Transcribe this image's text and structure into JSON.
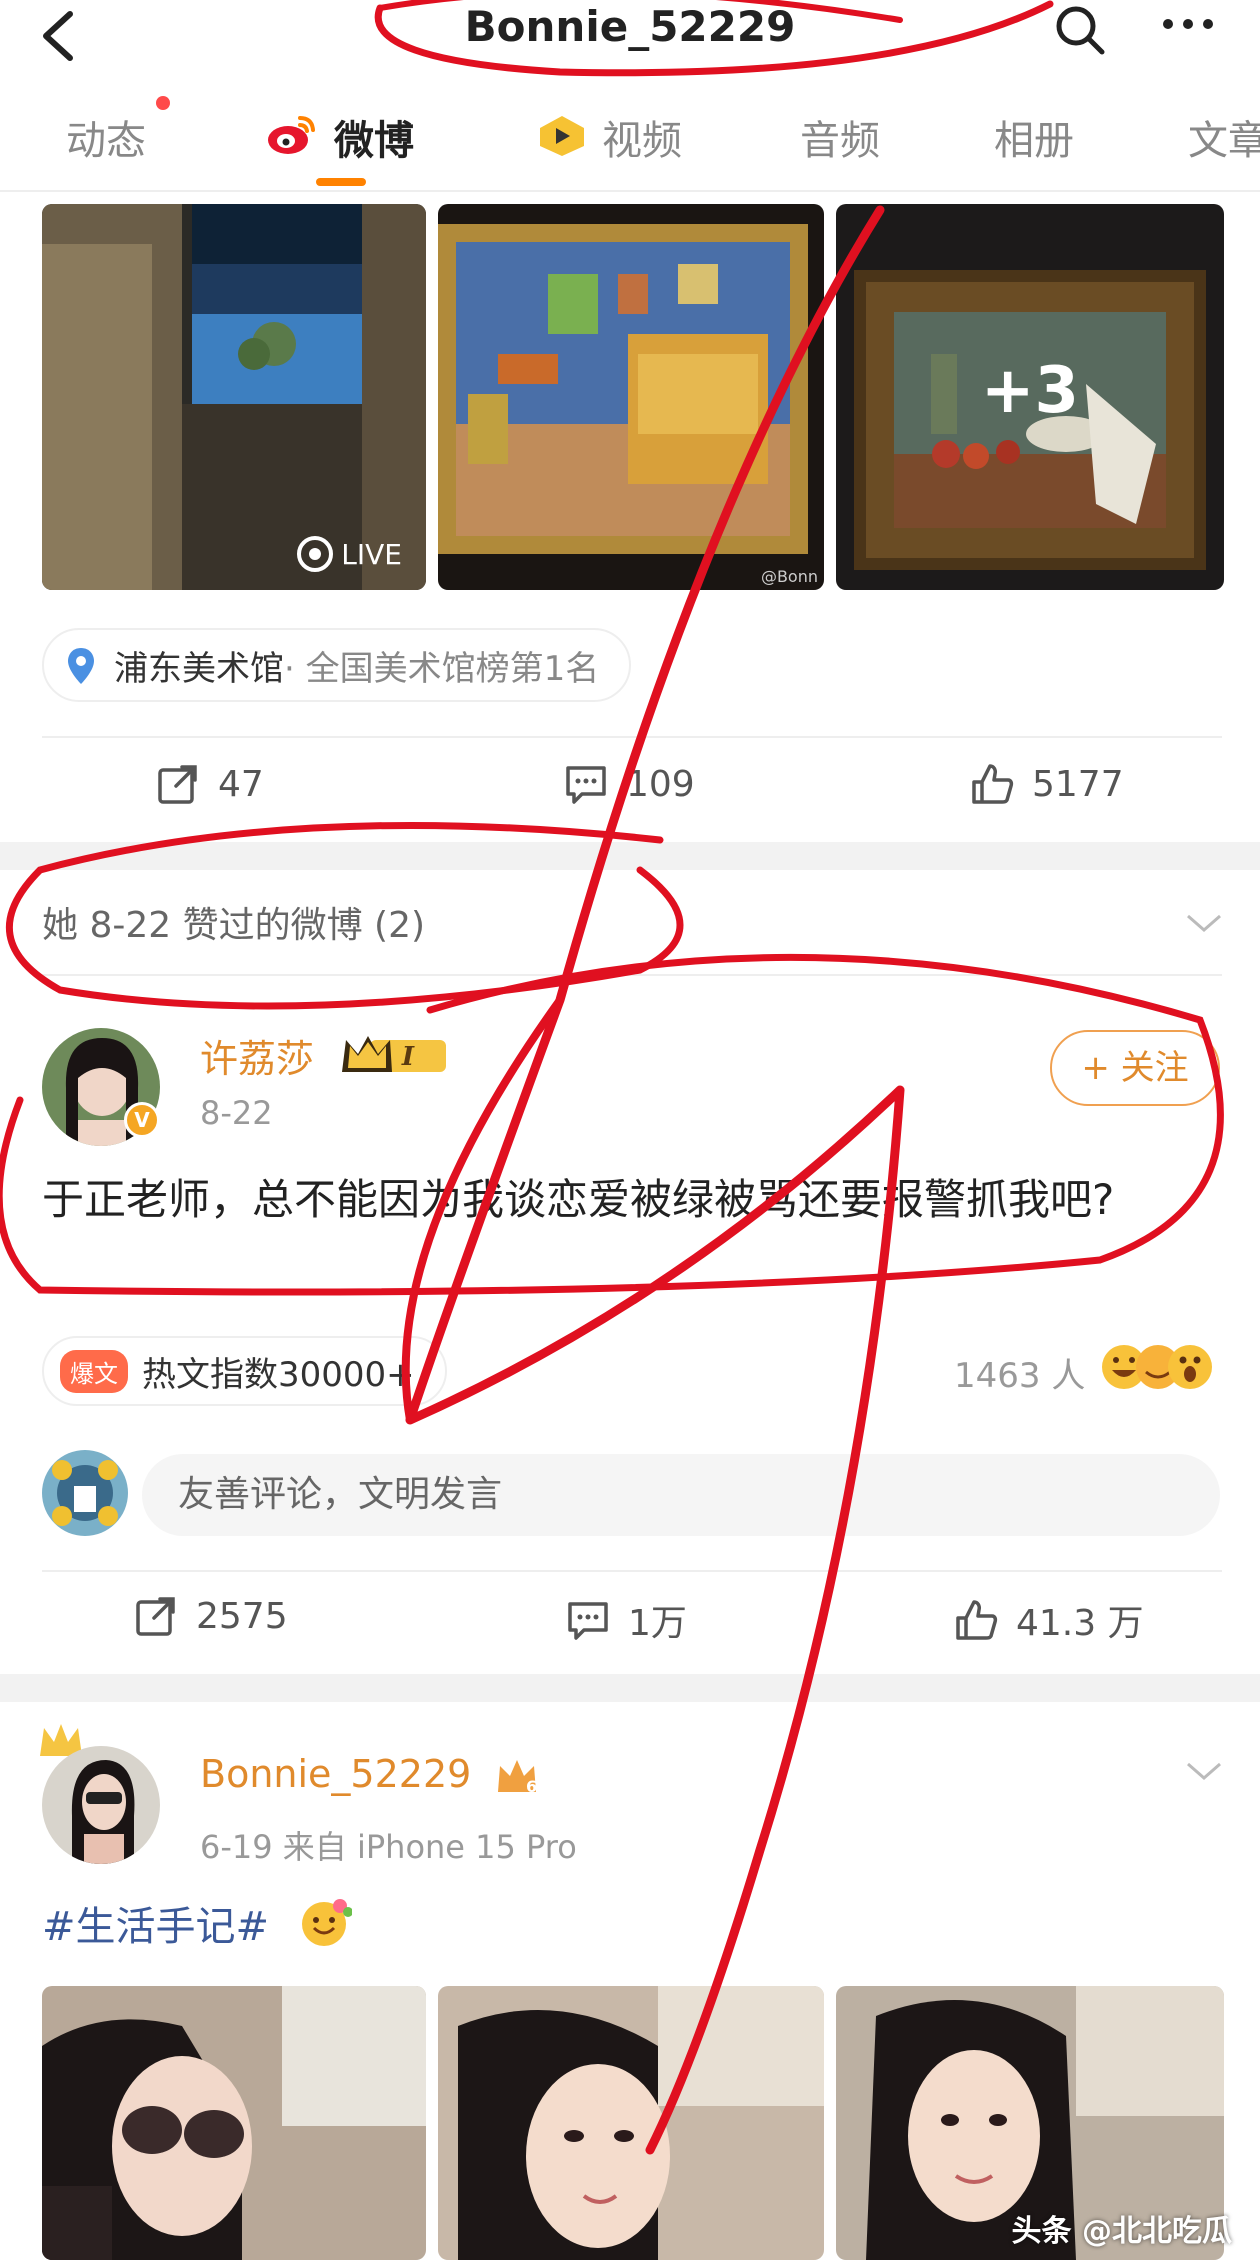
{
  "header": {
    "title": "Bonnie_52229"
  },
  "tabs": [
    {
      "label": "动态",
      "active": false,
      "has_dot": true
    },
    {
      "label": "微博",
      "active": true,
      "has_dot": false
    },
    {
      "label": "视频",
      "active": false,
      "has_dot": false
    },
    {
      "label": "音频",
      "active": false,
      "has_dot": false
    },
    {
      "label": "相册",
      "active": false,
      "has_dot": false
    },
    {
      "label": "文章",
      "active": false,
      "has_dot": false
    }
  ],
  "post1": {
    "images": [
      {
        "badge": "LIVE"
      },
      {
        "watermark": "@Bonn"
      },
      {
        "overlay": "+3"
      }
    ],
    "location": {
      "name": "浦东美术馆",
      "rank": "· 全国美术馆榜第1名"
    },
    "actions": {
      "share": "47",
      "comment": "109",
      "like": "5177"
    }
  },
  "liked_section": {
    "heading": "她 8-22 赞过的微博 (2)"
  },
  "post2": {
    "author": "许荔莎",
    "level": "I",
    "time": "8-22",
    "follow_label": "+ 关注",
    "text": "于正老师，总不能因为我谈恋爱被绿被骂还要报警抓我吧?",
    "hot_tag": "爆文",
    "hot_label": "热文指数30000+",
    "reaction_count": "1463 人",
    "comment_placeholder": "友善评论，文明发言",
    "actions": {
      "share": "2575",
      "comment": "1万",
      "like": "41.3 万"
    }
  },
  "post3": {
    "author": "Bonnie_52229",
    "meta": "6-19  来自 iPhone 15 Pro",
    "hashtag": "#生活手记#"
  },
  "watermark": "头条 @北北吃瓜",
  "colors": {
    "accent": "#ff8200",
    "username": "#e08a2c",
    "scribble": "#e01020"
  }
}
